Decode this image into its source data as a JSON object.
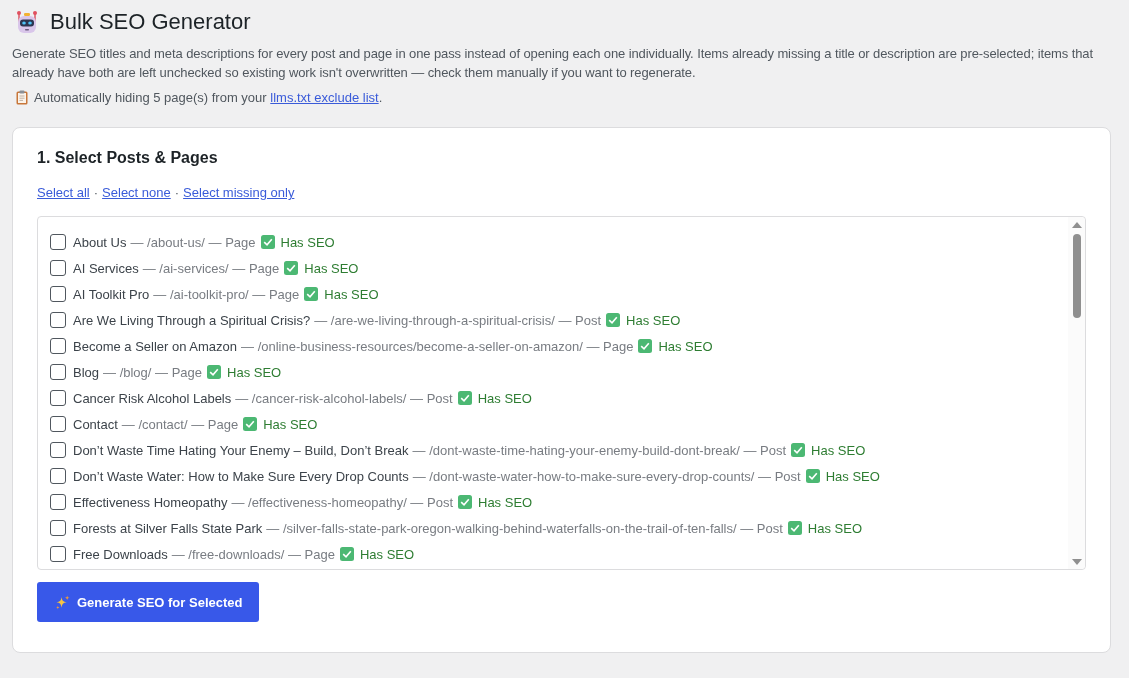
{
  "header": {
    "title": "Bulk SEO Generator",
    "description": "Generate SEO titles and meta descriptions for every post and page in one pass instead of opening each one individually. Items already missing a title or description are pre-selected; items that already have both are left unchecked so existing work isn't overwritten — check them manually if you want to regenerate.",
    "notice": {
      "text": "Automatically hiding 5 page(s) from your",
      "link": "llms.txt exclude list",
      "end": "."
    }
  },
  "section": {
    "heading": "1. Select Posts & Pages",
    "link_bar": [
      {
        "kind": "link",
        "text": "Select all"
      },
      {
        "kind": "separator",
        "text": "·"
      },
      {
        "kind": "link",
        "text": "Select none"
      },
      {
        "kind": "separator",
        "text": "·"
      },
      {
        "kind": "link",
        "text": "Select missing only"
      }
    ],
    "rows": [
      {
        "title": "About Us",
        "meta": "— /about-us/ — Page",
        "checked": false,
        "seo": {
          "kind": "has_seo",
          "label": "Has SEO"
        }
      },
      {
        "title": "AI Services",
        "meta": "— /ai-services/ — Page",
        "checked": false,
        "seo": {
          "kind": "has_seo",
          "label": "Has SEO"
        }
      },
      {
        "title": "AI Toolkit Pro",
        "meta": "— /ai-toolkit-pro/ — Page",
        "checked": false,
        "seo": {
          "kind": "has_seo",
          "label": "Has SEO"
        }
      },
      {
        "title": "Are We Living Through a Spiritual Crisis?",
        "meta": "— /are-we-living-through-a-spiritual-crisis/ — Post",
        "checked": false,
        "seo": {
          "kind": "has_seo",
          "label": "Has SEO"
        }
      },
      {
        "title": "Become a Seller on Amazon",
        "meta": "— /online-business-resources/become-a-seller-on-amazon/ — Page",
        "checked": false,
        "seo": {
          "kind": "has_seo",
          "label": "Has SEO"
        }
      },
      {
        "title": "Blog",
        "meta": "— /blog/ — Page",
        "checked": false,
        "seo": {
          "kind": "has_seo",
          "label": "Has SEO"
        }
      },
      {
        "title": "Cancer Risk Alcohol Labels",
        "meta": "— /cancer-risk-alcohol-labels/ — Post",
        "checked": false,
        "seo": {
          "kind": "has_seo",
          "label": "Has SEO"
        }
      },
      {
        "title": "Contact",
        "meta": "— /contact/ — Page",
        "checked": false,
        "seo": {
          "kind": "has_seo",
          "label": "Has SEO"
        }
      },
      {
        "title": "Don’t Waste Time Hating Your Enemy – Build, Don’t Break",
        "meta": "— /dont-waste-time-hating-your-enemy-build-dont-break/ — Post",
        "checked": false,
        "seo": {
          "kind": "has_seo",
          "label": "Has SEO"
        }
      },
      {
        "title": "Don’t Waste Water: How to Make Sure Every Drop Counts",
        "meta": "— /dont-waste-water-how-to-make-sure-every-drop-counts/ — Post",
        "checked": false,
        "seo": {
          "kind": "has_seo",
          "label": "Has SEO"
        }
      },
      {
        "title": "Effectiveness Homeopathy",
        "meta": "— /effectiveness-homeopathy/ — Post",
        "checked": false,
        "seo": {
          "kind": "has_seo",
          "label": "Has SEO"
        }
      },
      {
        "title": "Forests at Silver Falls State Park",
        "meta": "— /silver-falls-state-park-oregon-walking-behind-waterfalls-on-the-trail-of-ten-falls/ — Post",
        "checked": false,
        "seo": {
          "kind": "has_seo",
          "label": "Has SEO"
        }
      },
      {
        "title": "Free Downloads",
        "meta": "— /free-downloads/ — Page",
        "checked": false,
        "seo": {
          "kind": "has_seo",
          "label": "Has SEO"
        }
      }
    ],
    "button": {
      "label": "Generate SEO for Selected"
    }
  }
}
